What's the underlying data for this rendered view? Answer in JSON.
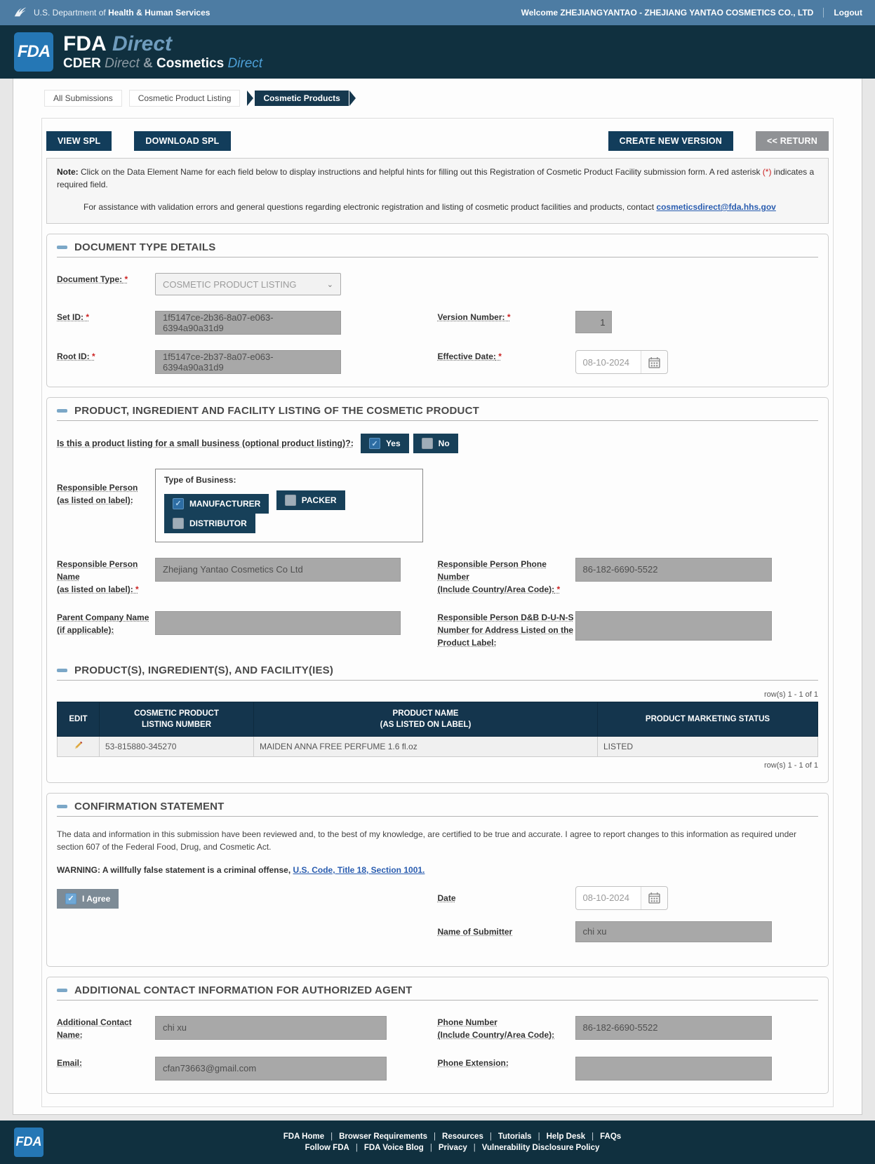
{
  "topbar": {
    "dept_prefix": "U.S. Department of",
    "dept_bold": "Health & Human Services",
    "welcome": "Welcome ZHEJIANGYANTAO - ZHEJIANG YANTAO COSMETICS CO., LTD",
    "logout": "Logout"
  },
  "brand": {
    "logo": "FDA",
    "title": "FDA",
    "title_accent": "Direct",
    "sub_cder": "CDER",
    "sub_direct1": "Direct",
    "sub_amp": "&",
    "sub_cosmetics": "Cosmetics",
    "sub_direct2": "Direct"
  },
  "breadcrumbs": {
    "items": [
      {
        "label": "All Submissions"
      },
      {
        "label": "Cosmetic Product Listing"
      },
      {
        "label": "Cosmetic Products"
      }
    ]
  },
  "toolbar": {
    "view_spl": "VIEW SPL",
    "download_spl": "DOWNLOAD SPL",
    "create_new_version": "CREATE NEW VERSION",
    "return": "<< RETURN"
  },
  "note": {
    "label": "Note:",
    "text1": " Click on the Data Element Name for each field below to display instructions and helpful hints for filling out this Registration of Cosmetic Product Facility submission form. A red asterisk ",
    "asterisk": "(*)",
    "text2": " indicates a required field.",
    "assistance_text": "For assistance with validation errors and general questions regarding electronic registration and listing of cosmetic product facilities and products, contact ",
    "assistance_link": "cosmeticsdirect@fda.hhs.gov"
  },
  "document_type": {
    "title": "DOCUMENT TYPE DETAILS",
    "document_type_label": "Document Type:",
    "document_type_value": "COSMETIC PRODUCT LISTING",
    "set_id_label": "Set ID:",
    "set_id_value": "1f5147ce-2b36-8a07-e063-6394a90a31d9",
    "root_id_label": "Root ID:",
    "root_id_value": "1f5147ce-2b37-8a07-e063-6394a90a31d9",
    "version_label": "Version Number:",
    "version_value": "1",
    "effective_date_label": "Effective Date:",
    "effective_date_value": "08-10-2024"
  },
  "product_listing": {
    "title": "PRODUCT, INGREDIENT AND FACILITY LISTING OF THE COSMETIC PRODUCT",
    "small_business_question": "Is this a product listing for a small business (optional product listing)?:",
    "yes_label": "Yes",
    "no_label": "No",
    "rp_label_l1": "Responsible Person",
    "rp_label_l2": "(as listed on label):",
    "type_of_business_label": "Type of Business:",
    "business_types": [
      {
        "label": "MANUFACTURER",
        "checked": true
      },
      {
        "label": "PACKER",
        "checked": false
      },
      {
        "label": "DISTRIBUTOR",
        "checked": false
      }
    ],
    "rp_name_label_l1": "Responsible Person Name",
    "rp_name_label_l2": "(as listed on label):",
    "rp_name_value": "Zhejiang Yantao Cosmetics Co Ltd",
    "rp_phone_label_l1": "Responsible Person Phone Number",
    "rp_phone_label_l2": "(Include Country/Area Code):",
    "rp_phone_value": "86-182-6690-5522",
    "parent_company_label_l1": "Parent Company Name",
    "parent_company_label_l2": "(if applicable):",
    "parent_company_value": "",
    "duns_label": "Responsible Person D&B D-U-N-S Number for Address Listed on the Product Label:",
    "duns_value": ""
  },
  "products_table": {
    "title": "PRODUCT(S), INGREDIENT(S), AND FACILITY(IES)",
    "rows_info": "row(s) 1 - 1 of 1",
    "headers": [
      {
        "l1": "EDIT",
        "l2": ""
      },
      {
        "l1": "COSMETIC PRODUCT",
        "l2": "LISTING NUMBER"
      },
      {
        "l1": "PRODUCT NAME",
        "l2": "(AS LISTED ON LABEL)"
      },
      {
        "l1": "PRODUCT MARKETING STATUS",
        "l2": ""
      }
    ],
    "rows": [
      {
        "listing_number": "53-815880-345270",
        "product_name": "MAIDEN ANNA FREE PERFUME 1.6 fl.oz",
        "status": "LISTED"
      }
    ]
  },
  "confirmation": {
    "title": "CONFIRMATION STATEMENT",
    "statement": "The data and information in this submission have been reviewed and, to the best of my knowledge, are certified to be true and accurate. I agree to report changes to this information as required under section 607 of the Federal Food, Drug, and Cosmetic Act.",
    "warning_text": "WARNING: A willfully false statement is a criminal offense, ",
    "warning_link": "U.S. Code, Title 18, Section 1001.",
    "agree_label": "I Agree",
    "date_label": "Date",
    "date_value": "08-10-2024",
    "submitter_label": "Name of Submitter",
    "submitter_value": "chi xu"
  },
  "additional_contact": {
    "title": "ADDITIONAL CONTACT INFORMATION FOR AUTHORIZED AGENT",
    "name_label_l1": "Additional Contact",
    "name_label_l2": "Name:",
    "name_value": "chi xu",
    "email_label": "Email:",
    "email_value": "cfan73663@gmail.com",
    "phone_label_l1": "Phone Number",
    "phone_label_l2": "(Include Country/Area Code):",
    "phone_value": "86-182-6690-5522",
    "ext_label": "Phone Extension:",
    "ext_value": ""
  },
  "footer": {
    "links_row1": [
      "FDA Home",
      "Browser Requirements",
      "Resources",
      "Tutorials",
      "Help Desk",
      "FAQs"
    ],
    "links_row2": [
      "Follow FDA",
      "FDA Voice Blog",
      "Privacy",
      "Vulnerability Disclosure Policy"
    ]
  },
  "colors": {
    "topbar": "#4d7ca3",
    "navy": "#10303f",
    "button_navy": "#123d5b",
    "table_header": "#14354d",
    "readonly_gray": "#a8a8a8",
    "accent_blue": "#2577b5",
    "required_red": "#cc2222"
  }
}
